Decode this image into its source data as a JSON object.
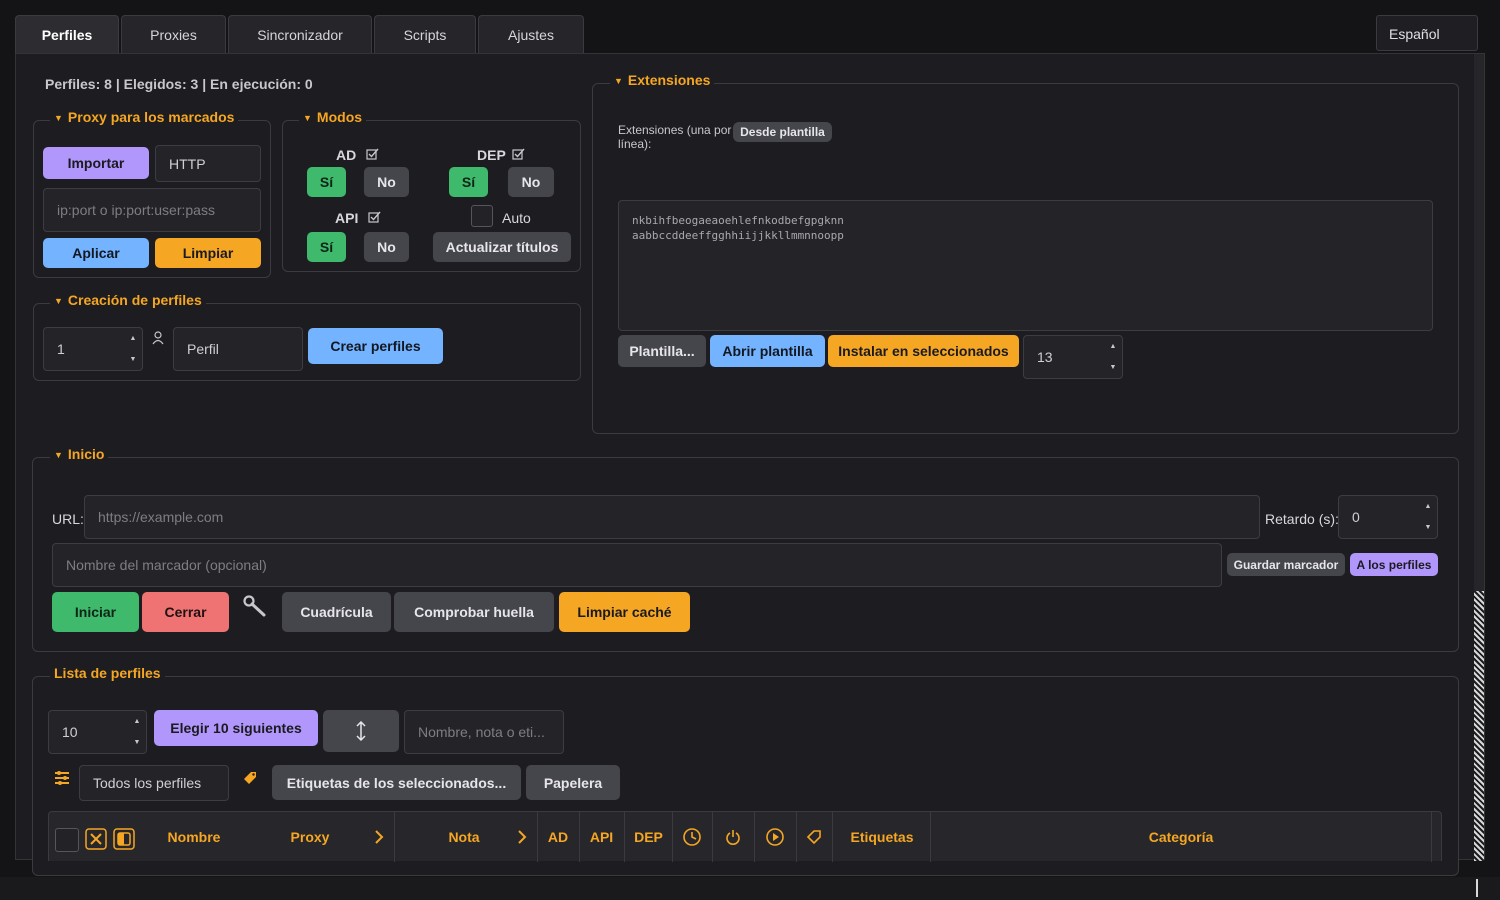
{
  "tabs": [
    "Perfiles",
    "Proxies",
    "Sincronizador",
    "Scripts",
    "Ajustes"
  ],
  "language": "Español",
  "stats": "Perfiles: 8 | Elegidos: 3 | En ejecución: 0",
  "proxy_group": {
    "title": "Proxy para los marcados",
    "import_label": "Importar",
    "type_value": "HTTP",
    "proxy_placeholder": "ip:port o ip:port:user:pass",
    "apply_label": "Aplicar",
    "clear_label": "Limpiar"
  },
  "modes_group": {
    "title": "Modos",
    "ad_label": "AD",
    "dep_label": "DEP",
    "api_label": "API",
    "yes_label": "Sí",
    "no_label": "No",
    "auto_label": "Auto",
    "update_titles_label": "Actualizar títulos"
  },
  "create_group": {
    "title": "Creación de perfiles",
    "count_value": "1",
    "name_value": "Perfil",
    "create_label": "Crear perfiles"
  },
  "extensions_group": {
    "title": "Extensiones",
    "desc_line1": "Extensiones (una por",
    "desc_line2": "línea):",
    "from_template_label": "Desde plantilla",
    "ext_line1": "nkbihfbeogaeaoehlefnkodbefgpgknn",
    "ext_line2": "aabbccddeeffgghhiijjkkllmmnnoopp",
    "template_label": "Plantilla...",
    "open_template_label": "Abrir plantilla",
    "install_label": "Instalar en seleccionados",
    "count_value": "13"
  },
  "start_group": {
    "title": "Inicio",
    "url_label": "URL:",
    "url_placeholder": "https://example.com",
    "delay_label": "Retardo (s):",
    "delay_value": "0",
    "bookmark_placeholder": "Nombre del marcador (opcional)",
    "save_bookmark_label": "Guardar marcador",
    "to_profiles_label": "A los perfiles",
    "start_label": "Iniciar",
    "close_label": "Cerrar",
    "grid_label": "Cuadrícula",
    "fingerprint_label": "Comprobar huella",
    "clear_cache_label": "Limpiar caché"
  },
  "profiles_list": {
    "title": "Lista de perfiles",
    "count_value": "10",
    "choose_next_label": "Elegir 10 siguientes",
    "search_placeholder": "Nombre, nota o eti...",
    "filter_value": "Todos los perfiles",
    "tags_selected_label": "Etiquetas de los seleccionados...",
    "trash_label": "Papelera",
    "columns": {
      "name": "Nombre",
      "proxy": "Proxy",
      "note": "Nota",
      "ad": "AD",
      "api": "API",
      "dep": "DEP",
      "tags": "Etiquetas",
      "category": "Categoría"
    }
  },
  "colors": {
    "accent": "#f5a623",
    "purple": "#b197fc",
    "blue": "#74b3ff",
    "green": "#3fb96b",
    "red": "#f07373",
    "background": "#1d1d21"
  }
}
